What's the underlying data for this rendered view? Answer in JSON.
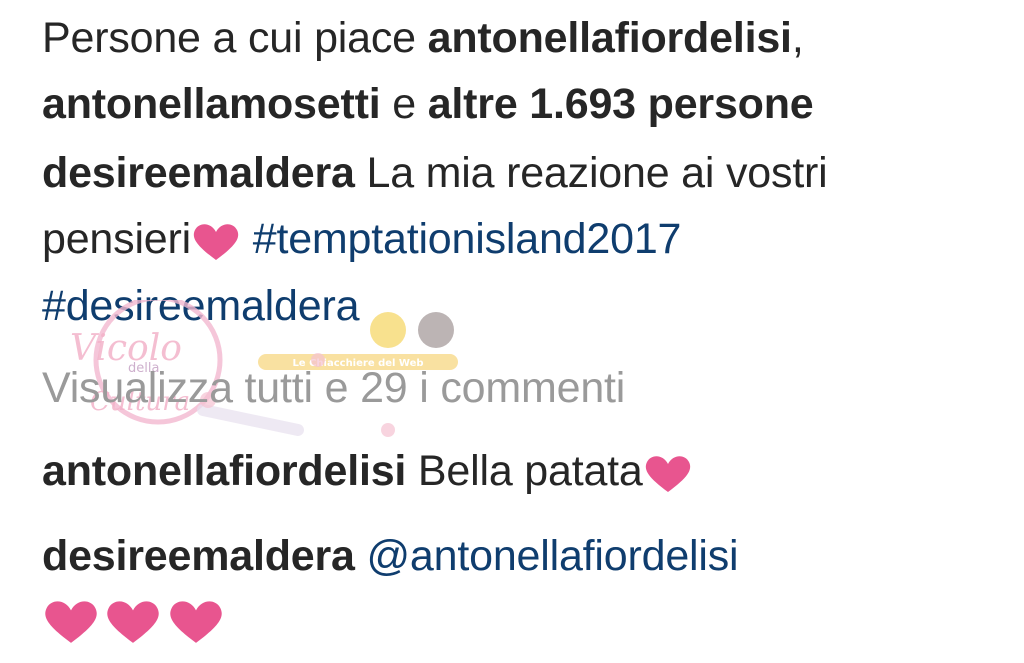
{
  "likes": {
    "prefix": "Persone a cui piace",
    "user1": "antonellafiordelisi",
    "comma": ",",
    "user2": "antonellamosetti",
    "conj": "e",
    "others": "altre 1.693 persone"
  },
  "caption": {
    "username": "desireemaldera",
    "text_line1": "La mia reazione ai vostri",
    "text_line2": "pensieri",
    "hashtag1": "#temptationisland2017",
    "hashtag2": "#desireemaldera"
  },
  "view_comments": "Visualizza tutti e 29 i commenti",
  "comments": [
    {
      "username": "antonellafiordelisi",
      "text": "Bella patata"
    },
    {
      "username": "desireemaldera",
      "mention": "@antonellafiordelisi"
    }
  ],
  "watermark": {
    "text1": "Vicolo",
    "text2": "della",
    "text3": "Cultura",
    "banner": "Le Chiacchiere del Web"
  },
  "colors": {
    "text": "#262626",
    "link": "#0f3d6e",
    "muted": "#9a9a9a",
    "heart": "#e8558f"
  },
  "icons": {
    "heart": "heart-icon"
  }
}
